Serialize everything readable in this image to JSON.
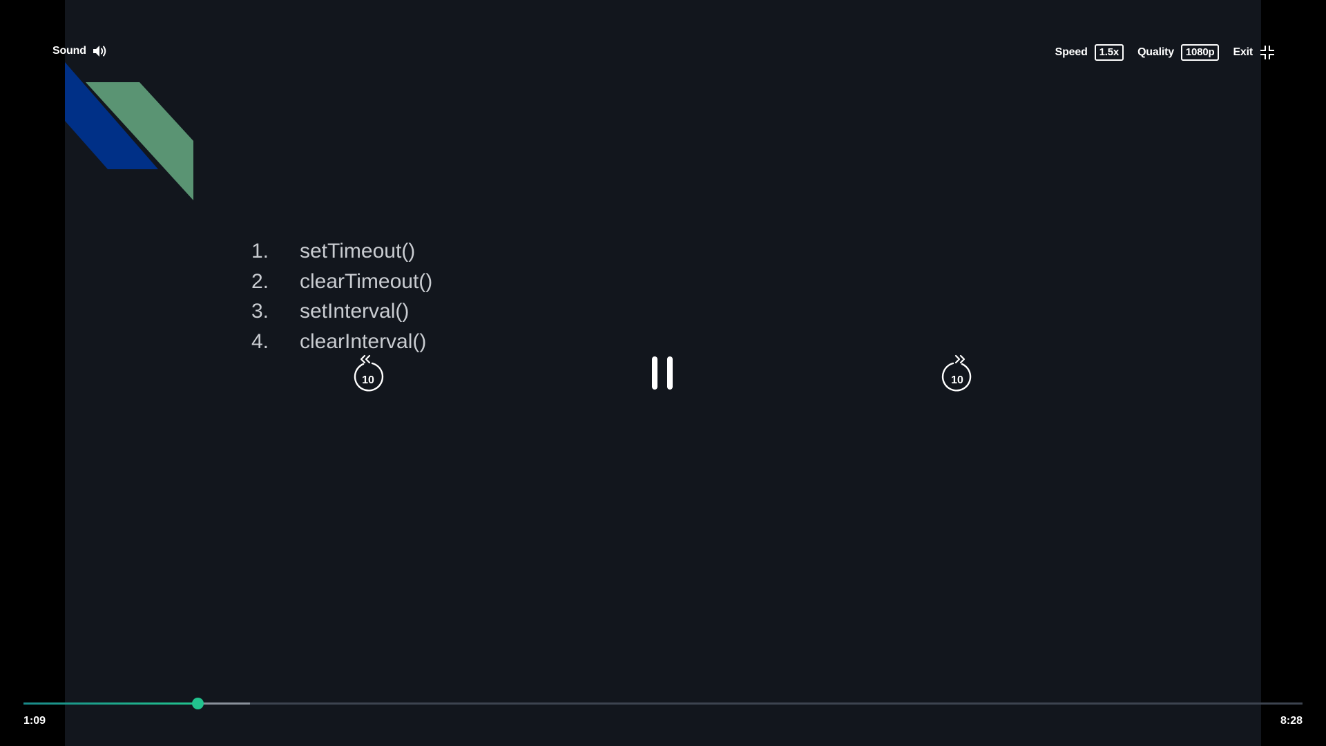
{
  "top_left": {
    "sound_label": "Sound",
    "sound_icon": "speaker-volume-icon"
  },
  "top_right": {
    "speed_label": "Speed",
    "speed_value": "1.5x",
    "quality_label": "Quality",
    "quality_value": "1080p",
    "exit_label": "Exit",
    "exit_icon": "exit-fullscreen-icon"
  },
  "slide": {
    "list": [
      {
        "num": "1.",
        "text": "setTimeout()"
      },
      {
        "num": "2.",
        "text": "clearTimeout()"
      },
      {
        "num": "3.",
        "text": "setInterval()"
      },
      {
        "num": "4.",
        "text": "clearInterval()"
      }
    ],
    "colors": {
      "background": "#12161d",
      "blue_shape": "#003087",
      "green_shape": "#5a9473"
    }
  },
  "center_controls": {
    "rewind_seconds": "10",
    "forward_seconds": "10",
    "state": "playing"
  },
  "progress": {
    "current_time": "1:09",
    "total_time": "8:28",
    "played_fraction": 0.1358,
    "buffered_fraction": 0.177,
    "accent_color": "#22c38e"
  }
}
